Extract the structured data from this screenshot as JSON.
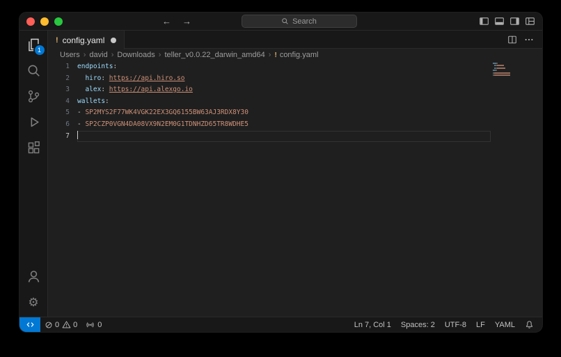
{
  "colors": {
    "accent": "#0078D4",
    "yaml_icon": "#DDB26E",
    "syntax_key": "#9CDCFE",
    "syntax_string": "#CE9178",
    "traffic_red": "#FF5F57",
    "traffic_yellow": "#FEBC2E",
    "traffic_green": "#28C840"
  },
  "titlebar": {
    "back_arrow": "←",
    "forward_arrow": "→",
    "search_label": "Search"
  },
  "activitybar": {
    "explorer_badge": "1"
  },
  "tabs": {
    "active": {
      "icon": "!",
      "label": "config.yaml",
      "modified": true
    }
  },
  "breadcrumb": {
    "separator": "›",
    "items": [
      "Users",
      "david",
      "Downloads",
      "teller_v0.0.22_darwin_amd64"
    ],
    "file_icon": "!",
    "file_label": "config.yaml"
  },
  "editor": {
    "lines": [
      {
        "num": "1",
        "tokens": [
          {
            "type": "key",
            "text": "endpoints"
          },
          {
            "type": "plain",
            "text": ":"
          }
        ]
      },
      {
        "num": "2",
        "tokens": [
          {
            "type": "plain",
            "text": "  "
          },
          {
            "type": "key",
            "text": "hiro"
          },
          {
            "type": "plain",
            "text": ": "
          },
          {
            "type": "link",
            "text": "https://api.hiro.so"
          }
        ]
      },
      {
        "num": "3",
        "tokens": [
          {
            "type": "plain",
            "text": "  "
          },
          {
            "type": "key",
            "text": "alex"
          },
          {
            "type": "plain",
            "text": ": "
          },
          {
            "type": "link",
            "text": "https://api.alexgo.io"
          }
        ]
      },
      {
        "num": "4",
        "tokens": [
          {
            "type": "key",
            "text": "wallets"
          },
          {
            "type": "plain",
            "text": ":"
          }
        ]
      },
      {
        "num": "5",
        "tokens": [
          {
            "type": "plain",
            "text": "- "
          },
          {
            "type": "string",
            "text": "SP2MYS2F77WK4VGK22EX3GQ6155BW63AJ3RDX8Y30"
          }
        ]
      },
      {
        "num": "6",
        "tokens": [
          {
            "type": "plain",
            "text": "- "
          },
          {
            "type": "string",
            "text": "SP2CZP0VGN4DA08VX9N2EM0G1TDNHZD65TR8WDHE5"
          }
        ]
      },
      {
        "num": "7",
        "tokens": [],
        "current": true,
        "cursor": true
      }
    ]
  },
  "statusbar": {
    "errors": "0",
    "warnings": "0",
    "ports": "0",
    "cursor_position": "Ln 7, Col 1",
    "indentation": "Spaces: 2",
    "encoding": "UTF-8",
    "eol": "LF",
    "language": "YAML"
  }
}
